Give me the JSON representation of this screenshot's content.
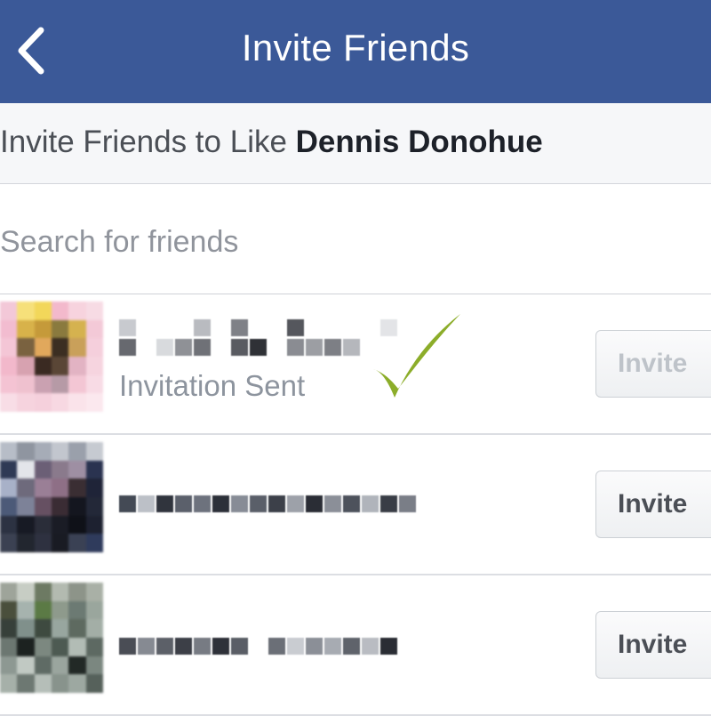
{
  "header": {
    "title": "Invite Friends",
    "back_icon": "chevron-left-icon"
  },
  "subheader": {
    "prefix": "Invite Friends to Like ",
    "page_name": "Dennis Donohue"
  },
  "search": {
    "placeholder": "Search for friends",
    "value": ""
  },
  "friends": [
    {
      "status": "Invitation Sent",
      "button_label": "Invite",
      "invited": true
    },
    {
      "button_label": "Invite",
      "invited": false
    },
    {
      "button_label": "Invite",
      "invited": false
    }
  ],
  "colors": {
    "navbar": "#3b5998",
    "checkmark": "#8cad2a",
    "muted_text": "#8d949e"
  }
}
